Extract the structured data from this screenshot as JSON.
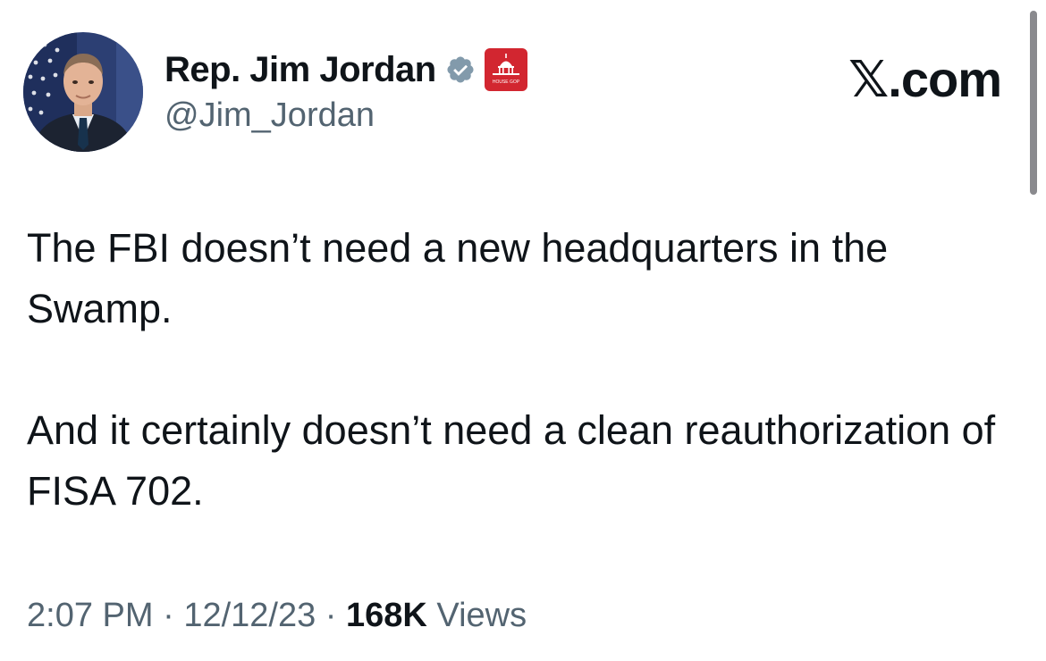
{
  "author": {
    "display_name": "Rep. Jim Jordan",
    "handle": "@Jim_Jordan",
    "verified_icon": "verified-badge-icon",
    "affiliation_icon": "house-gop-capitol-icon",
    "affiliation_badge_text": "HOUSE GOP"
  },
  "brand": {
    "label": "𝕏.com"
  },
  "tweet": {
    "paragraphs": [
      "The FBI doesn’t need a new headquarters in the Swamp.",
      "And it certainly doesn’t need a clean reauthorization of FISA 702."
    ]
  },
  "meta": {
    "time": "2:07 PM",
    "separator": "·",
    "date": "12/12/23",
    "views_count": "168K",
    "views_label": "Views"
  },
  "colors": {
    "text_primary": "#0f1419",
    "text_secondary": "#536471",
    "verified_badge": "#829aab",
    "affiliation_badge": "#d22630"
  }
}
